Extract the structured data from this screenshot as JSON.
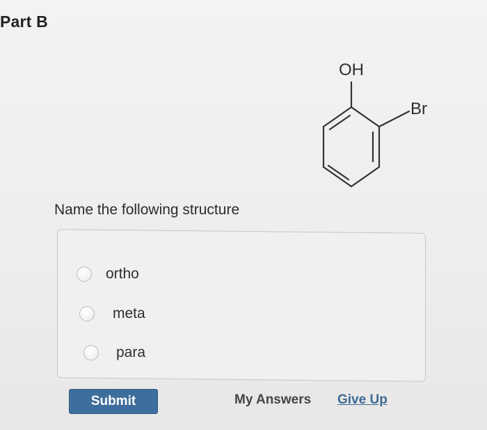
{
  "part": {
    "title": "Part B"
  },
  "structure": {
    "substituent_top": "OH",
    "substituent_right": "Br"
  },
  "question": {
    "prompt": "Name the following structure"
  },
  "choices": [
    {
      "label": "ortho",
      "selected": false
    },
    {
      "label": "meta",
      "selected": false
    },
    {
      "label": "para",
      "selected": false
    }
  ],
  "actions": {
    "submit_label": "Submit",
    "my_answers_label": "My Answers",
    "give_up_label": "Give Up"
  },
  "colors": {
    "submit_bg": "#3d6e9c",
    "link": "#3d6a95"
  }
}
